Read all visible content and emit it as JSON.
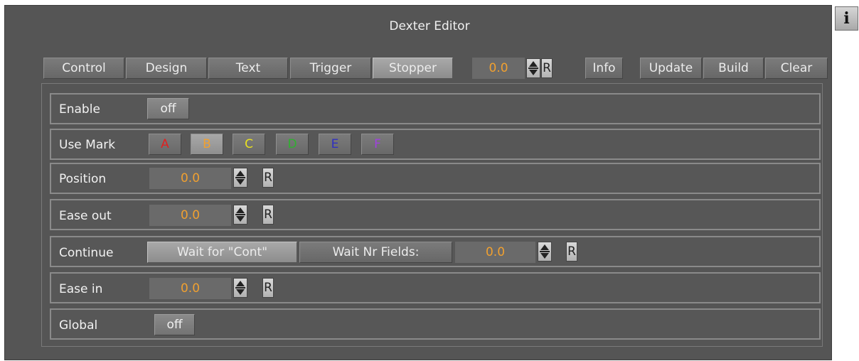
{
  "window": {
    "title": "Dexter Editor",
    "info_corner_label": "i"
  },
  "tabs": [
    {
      "label": "Control",
      "active": false
    },
    {
      "label": "Design",
      "active": false
    },
    {
      "label": "Text",
      "active": false
    },
    {
      "label": "Trigger",
      "active": false
    },
    {
      "label": "Stopper",
      "active": true
    }
  ],
  "toolbar": {
    "value": "0.0",
    "reset_label": "R",
    "info_label": "Info",
    "update_label": "Update",
    "build_label": "Build",
    "clear_label": "Clear"
  },
  "rows": {
    "enable": {
      "label": "Enable",
      "toggle": "off"
    },
    "use_mark": {
      "label": "Use Mark",
      "marks": [
        {
          "label": "A",
          "color": "#e02020",
          "active": false
        },
        {
          "label": "B",
          "color": "#f0a030",
          "active": true
        },
        {
          "label": "C",
          "color": "#e8e020",
          "active": false
        },
        {
          "label": "D",
          "color": "#30b030",
          "active": false
        },
        {
          "label": "E",
          "color": "#3030c0",
          "active": false
        },
        {
          "label": "F",
          "color": "#a040e0",
          "active": false
        }
      ]
    },
    "position": {
      "label": "Position",
      "value": "0.0",
      "reset": "R"
    },
    "ease_out": {
      "label": "Ease out",
      "value": "0.0",
      "reset": "R"
    },
    "continue": {
      "label": "Continue",
      "wait_cont_label": "Wait for \"Cont\"",
      "wait_fields_label": "Wait Nr Fields:",
      "value": "0.0",
      "reset": "R"
    },
    "ease_in": {
      "label": "Ease in",
      "value": "0.0",
      "reset": "R"
    },
    "global": {
      "label": "Global",
      "toggle": "off"
    }
  },
  "colors": {
    "panel": "#555555",
    "value_text": "#f0a030"
  }
}
